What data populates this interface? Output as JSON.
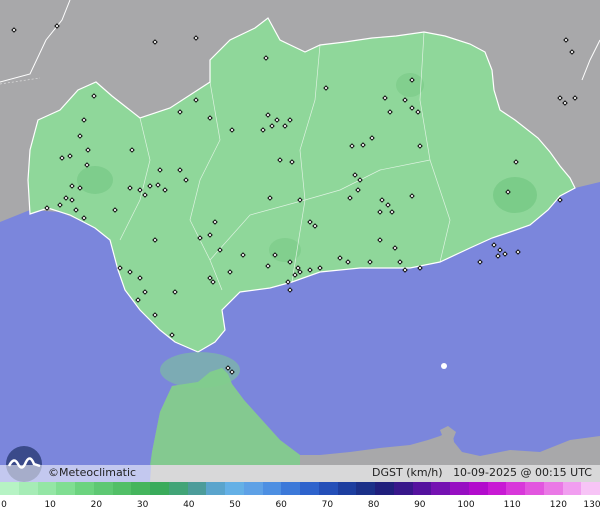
{
  "brand": {
    "name": "©Meteoclimatic"
  },
  "caption": {
    "variable": "DGST (km/h)",
    "timestamp": "10-09-2025 @ 00:15 UTC"
  },
  "legend": {
    "ticks": [
      "0",
      "10",
      "20",
      "30",
      "40",
      "50",
      "60",
      "70",
      "80",
      "90",
      "100",
      "110",
      "120",
      "130"
    ],
    "colors": [
      "#b6f3c4",
      "#a6ecb6",
      "#94e6a5",
      "#80de92",
      "#6cd37f",
      "#5ec873",
      "#52bf67",
      "#45b55d",
      "#3aab5b",
      "#42a477",
      "#4c9c9a",
      "#5aa4cc",
      "#64b0e6",
      "#5ea1e6",
      "#4d8fe2",
      "#3c79d9",
      "#2e63cc",
      "#244fb8",
      "#1d3e9f",
      "#1b3088",
      "#201f7c",
      "#38178a",
      "#55129e",
      "#7512b2",
      "#970fc2",
      "#b20ccc",
      "#c81ad4",
      "#d838da",
      "#e256df",
      "#ea79e6",
      "#f19ef0",
      "#f7c4f6"
    ]
  },
  "map": {
    "region": "Andalucía",
    "colors": {
      "sea": "#7b86dc",
      "land_outside": "#a8a8aa",
      "region_fill": "#8fd79a",
      "borders": "#ffffff",
      "station": "#000000"
    }
  }
}
